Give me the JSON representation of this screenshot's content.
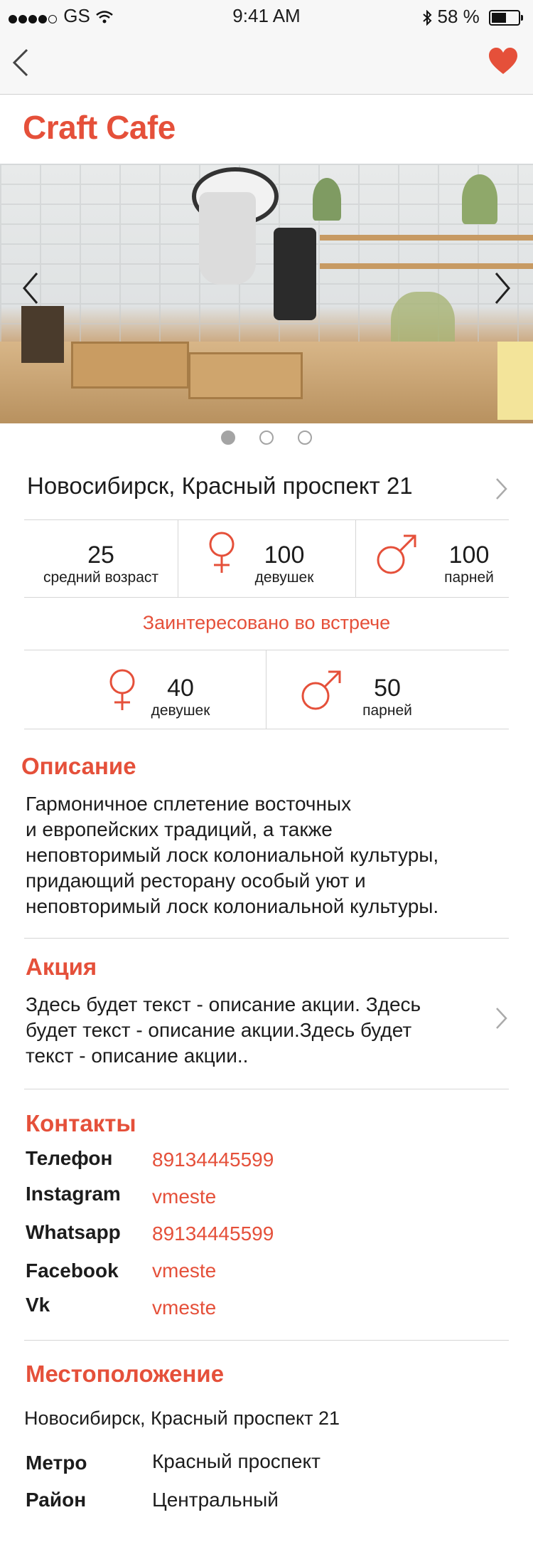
{
  "status": {
    "carrier": "GS",
    "time": "9:41 AM",
    "battery": "58 %"
  },
  "venue": {
    "name": "Craft Cafe",
    "address": "Новосибирск, Красный проспект 21"
  },
  "stats": {
    "age_value": "25",
    "age_label": "средний возраст",
    "girls_value": "100",
    "girls_label": "девушек",
    "guys_value": "100",
    "guys_label": "парней"
  },
  "interested": {
    "title": "Заинтересовано во встрече",
    "girls_value": "40",
    "girls_label": "девушек",
    "guys_value": "50",
    "guys_label": "парней"
  },
  "description": {
    "title": "Описание",
    "lines": [
      "Гармоничное сплетение восточных",
      "и европейских традиций, а также",
      "неповторимый лоск колониальной культуры,",
      "придающий ресторану особый уют и",
      "неповторимый лоск колониальной культуры."
    ]
  },
  "promo": {
    "title": "Акция",
    "lines": [
      "Здесь будет текст - описание акции. Здесь",
      "будет текст - описание акции.Здесь будет",
      "текст - описание акции.."
    ]
  },
  "contacts": {
    "title": "Контакты",
    "rows": [
      {
        "label": "Телефон",
        "value": "89134445599"
      },
      {
        "label": "Instagram",
        "value": "vmeste"
      },
      {
        "label": "Whatsapp",
        "value": "89134445599"
      },
      {
        "label": "Facebook",
        "value": "vmeste"
      },
      {
        "label": "Vk",
        "value": "vmeste"
      }
    ]
  },
  "location": {
    "title": "Местоположение",
    "address": "Новосибирск, Красный проспект 21",
    "metro_label": "Метро",
    "metro_value": "Красный проспект",
    "district_label": "Район",
    "district_value": "Центральный"
  },
  "gallery": {
    "active_index": 0,
    "count": 3
  },
  "colors": {
    "accent": "#e5503a",
    "divider": "#d6d6d6"
  }
}
